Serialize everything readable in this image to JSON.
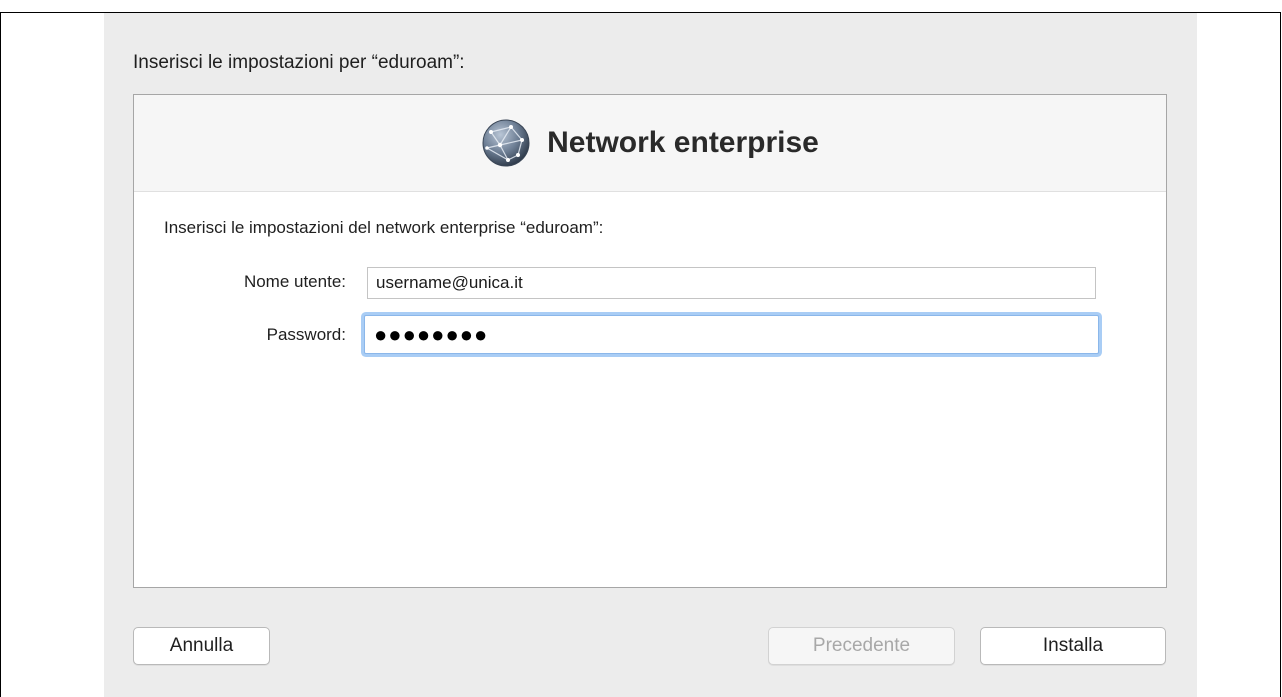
{
  "dialog": {
    "prompt": "Inserisci le impostazioni per “eduroam”:"
  },
  "panel": {
    "title": "Network enterprise",
    "icon": "globe-network-icon",
    "prompt": "Inserisci le impostazioni del network enterprise “eduroam”:",
    "username": {
      "label": "Nome utente:",
      "value": "username@unica.it"
    },
    "password": {
      "label": "Password:",
      "value": "●●●●●●●●"
    }
  },
  "buttons": {
    "cancel": "Annulla",
    "previous": "Precedente",
    "install": "Installa"
  },
  "colors": {
    "focus_ring": "#a9cdf5",
    "dialog_bg": "#ececec"
  }
}
